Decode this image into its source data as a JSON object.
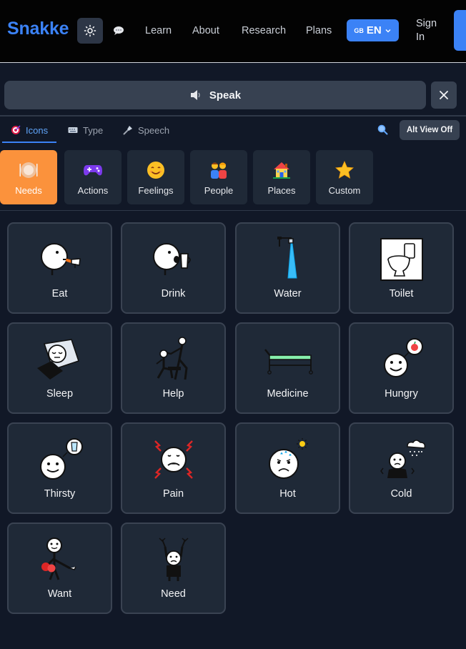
{
  "header": {
    "logo": "Snakke",
    "nav": [
      {
        "label": "Learn"
      },
      {
        "label": "About"
      },
      {
        "label": "Research"
      },
      {
        "label": "Plans"
      }
    ],
    "language": {
      "flag": "GB",
      "code": "EN"
    },
    "signin": "Sign In"
  },
  "speak": {
    "label": "Speak"
  },
  "tabs": [
    {
      "label": "Icons",
      "active": true
    },
    {
      "label": "Type",
      "active": false
    },
    {
      "label": "Speech",
      "active": false
    }
  ],
  "alt_view": {
    "label": "Alt View Off"
  },
  "categories": [
    {
      "label": "Needs",
      "icon": "plate-icon",
      "active": true
    },
    {
      "label": "Actions",
      "icon": "gamepad-icon",
      "active": false
    },
    {
      "label": "Feelings",
      "icon": "smiley-icon",
      "active": false
    },
    {
      "label": "People",
      "icon": "people-icon",
      "active": false
    },
    {
      "label": "Places",
      "icon": "house-icon",
      "active": false
    },
    {
      "label": "Custom",
      "icon": "star-icon",
      "active": false
    }
  ],
  "symbols": [
    {
      "label": "Eat",
      "icon": "eat-icon"
    },
    {
      "label": "Drink",
      "icon": "drink-icon"
    },
    {
      "label": "Water",
      "icon": "water-icon"
    },
    {
      "label": "Toilet",
      "icon": "toilet-icon"
    },
    {
      "label": "Sleep",
      "icon": "sleep-icon"
    },
    {
      "label": "Help",
      "icon": "help-icon"
    },
    {
      "label": "Medicine",
      "icon": "medicine-icon"
    },
    {
      "label": "Hungry",
      "icon": "hungry-icon"
    },
    {
      "label": "Thirsty",
      "icon": "thirsty-icon"
    },
    {
      "label": "Pain",
      "icon": "pain-icon"
    },
    {
      "label": "Hot",
      "icon": "hot-icon"
    },
    {
      "label": "Cold",
      "icon": "cold-icon"
    },
    {
      "label": "Want",
      "icon": "want-icon"
    },
    {
      "label": "Need",
      "icon": "need-icon"
    }
  ],
  "colors": {
    "accent": "#3b82f6",
    "active_category": "#fb923c",
    "background": "#111827",
    "card": "#1f2937"
  }
}
